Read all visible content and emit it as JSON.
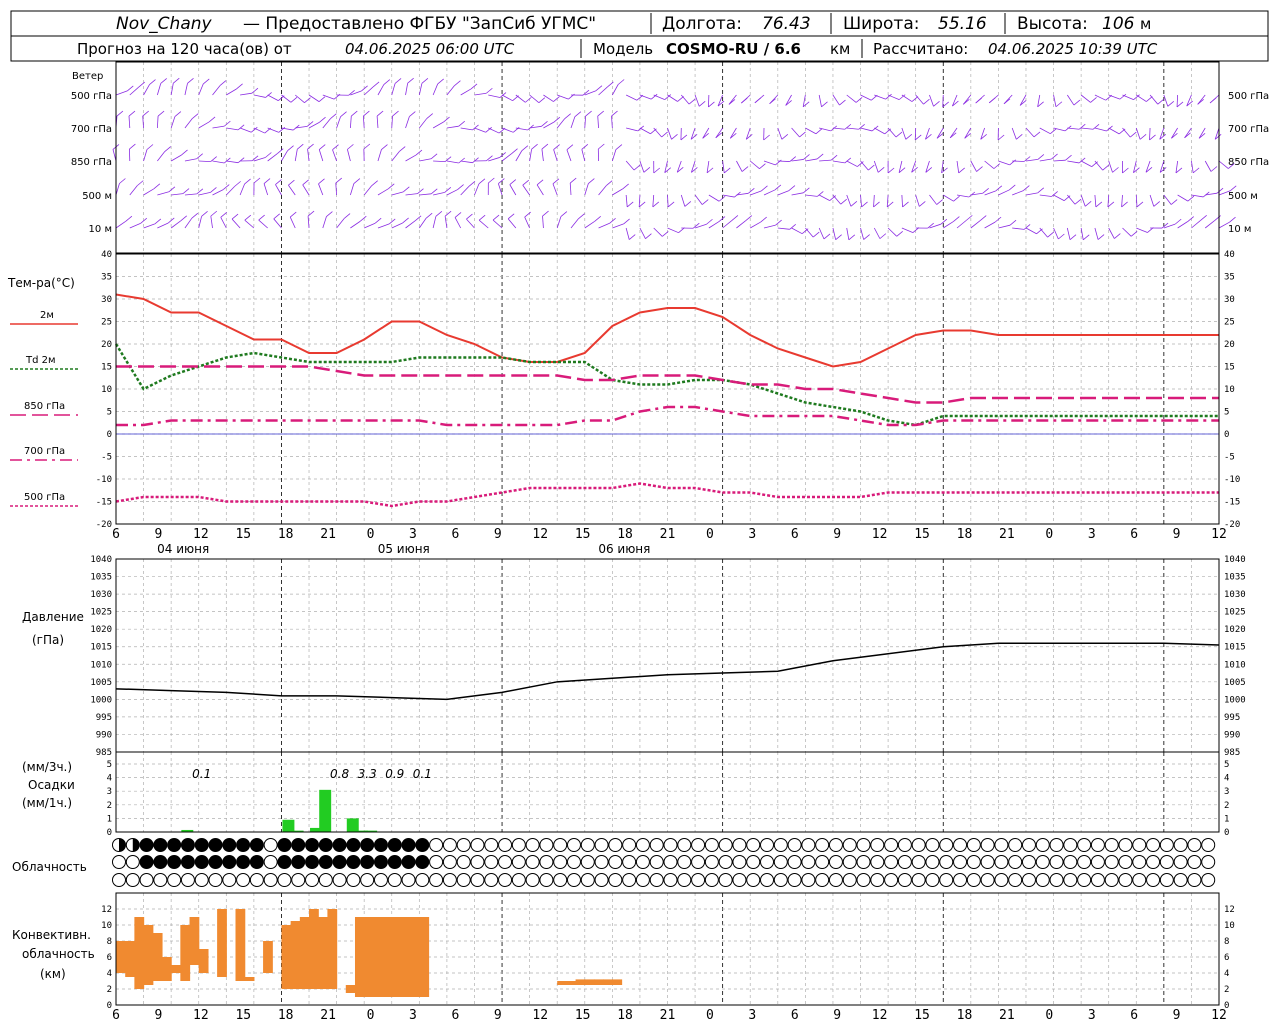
{
  "header": {
    "station": "Nov_Chany",
    "provider": "— Предоставлено ФГБУ \"ЗапСиб УГМС\"",
    "lon_label": "Долгота:",
    "lon": "76.43",
    "lat_label": "Широта:",
    "lat": "55.16",
    "alt_label": "Высота:",
    "alt": "106",
    "alt_unit": "м",
    "forecast_prefix": "Прогноз на 120 часа(ов) от",
    "forecast_time": "04.06.2025 06:00 UTC",
    "model_label": "Модель",
    "model": "COSMO-RU / 6.6",
    "model_unit": "км",
    "calc_label": "Рассчитано:",
    "calc_time": "04.06.2025 10:39 UTC"
  },
  "wind_panel": {
    "title": "Ветер",
    "levels": [
      "500 гПа",
      "700 гПа",
      "850 гПа",
      "500 м",
      "10  м"
    ]
  },
  "temp_panel": {
    "title": "Тем-ра(°C)",
    "legend": [
      "2м",
      "Td  2м",
      "850 гПа",
      "700 гПа",
      "500 гПа"
    ]
  },
  "pressure_panel": {
    "title_line1": "Давление",
    "title_line2": "(гПа)"
  },
  "precip_panel": {
    "title_line1": "(мм/3ч.)",
    "title_line2": "Осадки",
    "title_line3": "(мм/1ч.)"
  },
  "cloud_panel": {
    "title": "Облачность"
  },
  "conv_panel": {
    "title_line1": "Конвективн.",
    "title_line2": "облачность",
    "title_line3": "(км)"
  },
  "x_ticks": [
    "6",
    "9",
    "12",
    "15",
    "18",
    "21",
    "0",
    "3",
    "6",
    "9",
    "12",
    "15",
    "18",
    "21",
    "0",
    "3",
    "6",
    "9",
    "12",
    "15",
    "18",
    "21",
    "0",
    "3",
    "6",
    "9",
    "12"
  ],
  "date_labels": [
    "04 июня",
    "05 июня",
    "06 июня"
  ],
  "colors": {
    "t2m": "#e83a30",
    "td2m": "#1f7a1f",
    "t850": "#d81b7a",
    "t700": "#d81b7a",
    "t500": "#d81b7a",
    "wind": "#8a2be2",
    "precip": "#22cc22",
    "conv": "#f08a30",
    "pressure": "#000000"
  },
  "chart_data": [
    {
      "type": "line",
      "title": "Тем-ра(°C)",
      "x_hours_from_04_06_0600": [
        0,
        3,
        6,
        9,
        12,
        15,
        18,
        21,
        24,
        27,
        30,
        33,
        36,
        39,
        42,
        45,
        48,
        51,
        54,
        57,
        60,
        63,
        66,
        69,
        72,
        75,
        78,
        81,
        84,
        87,
        90,
        93,
        96,
        99,
        102,
        105,
        108,
        111,
        114,
        117,
        120
      ],
      "ylim": [
        -20,
        40
      ],
      "series": [
        {
          "name": "2м",
          "values": [
            31,
            30,
            27,
            27,
            24,
            21,
            21,
            18,
            18,
            21,
            25,
            25,
            22,
            20,
            17,
            16,
            16,
            18,
            24,
            27,
            28,
            28,
            26,
            22,
            19,
            17,
            15,
            16,
            19,
            22,
            23,
            23,
            22,
            22,
            22,
            22,
            22,
            22,
            22,
            22,
            22
          ]
        },
        {
          "name": "Td  2м",
          "values": [
            20,
            10,
            13,
            15,
            17,
            18,
            17,
            16,
            16,
            16,
            16,
            17,
            17,
            17,
            17,
            16,
            16,
            16,
            12,
            11,
            11,
            12,
            12,
            11,
            9,
            7,
            6,
            5,
            3,
            2,
            4,
            4,
            4,
            4,
            4,
            4,
            4,
            4,
            4,
            4,
            4
          ]
        },
        {
          "name": "850 гПа",
          "values": [
            15,
            15,
            15,
            15,
            15,
            15,
            15,
            15,
            14,
            13,
            13,
            13,
            13,
            13,
            13,
            13,
            13,
            12,
            12,
            13,
            13,
            13,
            12,
            11,
            11,
            10,
            10,
            9,
            8,
            7,
            7,
            8,
            8,
            8,
            8,
            8,
            8,
            8,
            8,
            8,
            8
          ]
        },
        {
          "name": "700 гПа",
          "values": [
            2,
            2,
            3,
            3,
            3,
            3,
            3,
            3,
            3,
            3,
            3,
            3,
            2,
            2,
            2,
            2,
            2,
            3,
            3,
            5,
            6,
            6,
            5,
            4,
            4,
            4,
            4,
            3,
            2,
            2,
            3,
            3,
            3,
            3,
            3,
            3,
            3,
            3,
            3,
            3,
            3
          ]
        },
        {
          "name": "500 гПа",
          "values": [
            -15,
            -14,
            -14,
            -14,
            -15,
            -15,
            -15,
            -15,
            -15,
            -15,
            -16,
            -15,
            -15,
            -14,
            -13,
            -12,
            -12,
            -12,
            -12,
            -11,
            -12,
            -12,
            -13,
            -13,
            -14,
            -14,
            -14,
            -14,
            -13,
            -13,
            -13,
            -13,
            -13,
            -13,
            -13,
            -13,
            -13,
            -13,
            -13,
            -13,
            -13
          ]
        }
      ]
    },
    {
      "type": "line",
      "title": "Давление (гПа)",
      "x_hours_from_04_06_0600": [
        0,
        6,
        12,
        18,
        24,
        30,
        36,
        42,
        48,
        54,
        60,
        66,
        72,
        78,
        84,
        90,
        96,
        102,
        108,
        114,
        120
      ],
      "ylim": [
        985,
        1040
      ],
      "series": [
        {
          "name": "Давление",
          "values": [
            1003,
            1002.5,
            1002,
            1001,
            1001,
            1000.5,
            1000,
            1002,
            1005,
            1006,
            1007,
            1007.5,
            1008,
            1011,
            1013,
            1015,
            1016,
            1016,
            1016,
            1016,
            1015.5
          ]
        }
      ]
    },
    {
      "type": "bar",
      "title": "Осадки (мм/3ч.)",
      "ylim": [
        0,
        5
      ],
      "labels": [
        {
          "x_hours": 9,
          "text": "0.1"
        },
        {
          "x_hours": 24,
          "text": "0.8"
        },
        {
          "x_hours": 27,
          "text": "3.3"
        },
        {
          "x_hours": 30,
          "text": "0.9"
        },
        {
          "x_hours": 33,
          "text": "0.1"
        }
      ],
      "hourly_bars": [
        {
          "x_hours": 7,
          "value": 0.15
        },
        {
          "x_hours": 18,
          "value": 0.9
        },
        {
          "x_hours": 19,
          "value": 0.1
        },
        {
          "x_hours": 21,
          "value": 0.3
        },
        {
          "x_hours": 22,
          "value": 3.1
        },
        {
          "x_hours": 25,
          "value": 1.0
        },
        {
          "x_hours": 26,
          "value": 0.1
        },
        {
          "x_hours": 27,
          "value": 0.1
        }
      ]
    },
    {
      "type": "bar",
      "title": "Конвективн. облачность (км)",
      "ylim": [
        0,
        13
      ],
      "ranges": [
        {
          "x_hours": 0,
          "base": 4,
          "top": 8
        },
        {
          "x_hours": 1,
          "base": 3.5,
          "top": 8
        },
        {
          "x_hours": 2,
          "base": 2,
          "top": 11
        },
        {
          "x_hours": 3,
          "base": 2.5,
          "top": 10
        },
        {
          "x_hours": 4,
          "base": 3,
          "top": 9
        },
        {
          "x_hours": 5,
          "base": 3,
          "top": 6
        },
        {
          "x_hours": 6,
          "base": 4,
          "top": 5
        },
        {
          "x_hours": 7,
          "base": 3,
          "top": 10
        },
        {
          "x_hours": 8,
          "base": 5,
          "top": 11
        },
        {
          "x_hours": 9,
          "base": 4,
          "top": 7
        },
        {
          "x_hours": 11,
          "base": 3.5,
          "top": 12
        },
        {
          "x_hours": 13,
          "base": 3,
          "top": 12
        },
        {
          "x_hours": 14,
          "base": 3,
          "top": 3.5
        },
        {
          "x_hours": 16,
          "base": 4,
          "top": 8
        },
        {
          "x_hours": 18,
          "base": 2,
          "top": 10
        },
        {
          "x_hours": 19,
          "base": 2,
          "top": 10.5
        },
        {
          "x_hours": 20,
          "base": 2,
          "top": 11
        },
        {
          "x_hours": 21,
          "base": 2,
          "top": 12
        },
        {
          "x_hours": 22,
          "base": 2,
          "top": 11
        },
        {
          "x_hours": 23,
          "base": 2,
          "top": 12
        },
        {
          "x_hours": 25,
          "base": 1.5,
          "top": 2.5
        },
        {
          "x_hours": 26,
          "base": 1,
          "top": 11
        },
        {
          "x_hours": 27,
          "base": 1,
          "top": 11
        },
        {
          "x_hours": 28,
          "base": 1,
          "top": 11
        },
        {
          "x_hours": 29,
          "base": 1,
          "top": 11
        },
        {
          "x_hours": 30,
          "base": 1,
          "top": 11
        },
        {
          "x_hours": 31,
          "base": 1,
          "top": 11
        },
        {
          "x_hours": 32,
          "base": 1,
          "top": 11
        },
        {
          "x_hours": 33,
          "base": 1,
          "top": 11
        },
        {
          "x_hours": 48,
          "base": 2.5,
          "top": 3
        },
        {
          "x_hours": 49,
          "base": 2.5,
          "top": 3
        },
        {
          "x_hours": 50,
          "base": 2.5,
          "top": 3.2
        },
        {
          "x_hours": 51,
          "base": 2.5,
          "top": 3.2
        },
        {
          "x_hours": 52,
          "base": 2.5,
          "top": 3.2
        },
        {
          "x_hours": 53,
          "base": 2.5,
          "top": 3.2
        },
        {
          "x_hours": 54,
          "base": 2.5,
          "top": 3.2
        }
      ]
    }
  ]
}
